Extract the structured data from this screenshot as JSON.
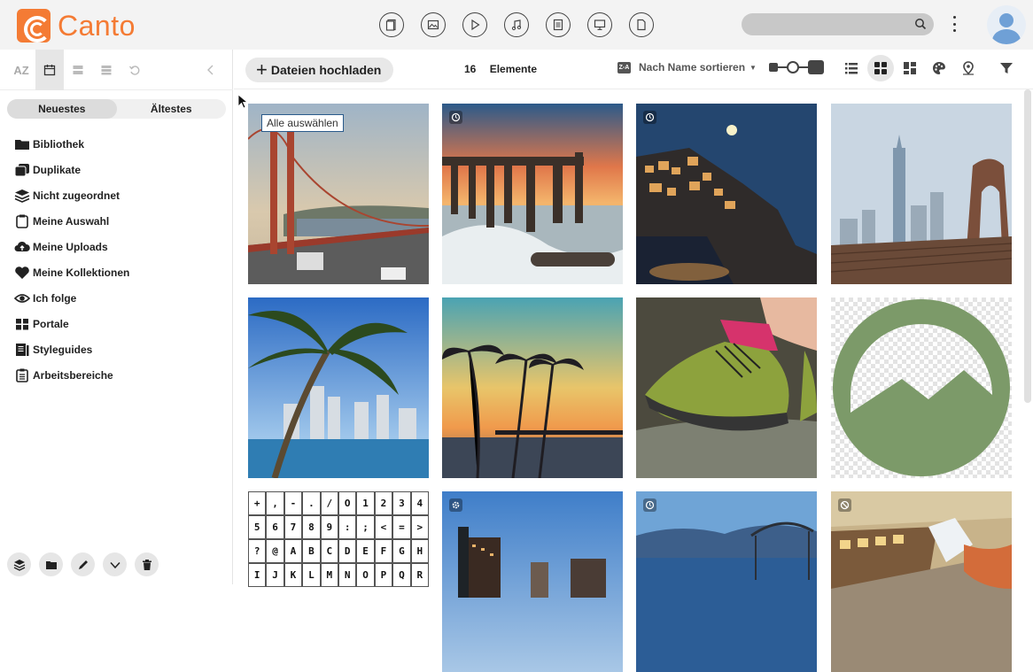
{
  "app": {
    "name": "Canto",
    "brand_color": "#f47b34"
  },
  "header": {
    "type_icons": [
      "document-icon",
      "image-icon",
      "video-icon",
      "audio-icon",
      "text-doc-icon",
      "presentation-icon",
      "other-file-icon"
    ],
    "search": {
      "placeholder": "",
      "value": ""
    }
  },
  "sidebar": {
    "sort_buttons": [
      "AZ",
      "calendar-icon",
      "size-icon",
      "layer-icon",
      "reset-icon"
    ],
    "sort_az_label": "AZ",
    "segments": {
      "newest": "Neuestes",
      "oldest": "Ältestes"
    },
    "items": [
      {
        "label": "Bibliothek",
        "icon": "folder-icon"
      },
      {
        "label": "Duplikate",
        "icon": "duplicate-icon"
      },
      {
        "label": "Nicht zugeordnet",
        "icon": "layers-icon"
      },
      {
        "label": "Meine Auswahl",
        "icon": "clipboard-icon"
      },
      {
        "label": "Meine Uploads",
        "icon": "cloud-upload-icon"
      },
      {
        "label": "Meine Kollektionen",
        "icon": "heart-icon"
      },
      {
        "label": "Ich folge",
        "icon": "eye-icon"
      },
      {
        "label": "Portale",
        "icon": "grid-icon"
      },
      {
        "label": "Styleguides",
        "icon": "book-icon"
      },
      {
        "label": "Arbeitsbereiche",
        "icon": "workspace-icon"
      }
    ]
  },
  "toolbar": {
    "upload_label": "Dateien hochladen",
    "count": "16",
    "count_label": "Elemente",
    "sort_badge": "Z-A",
    "sort_label": "Nach Name sortieren"
  },
  "grid": {
    "select_all_label": "Alle auswählen",
    "chart_symbols": [
      "+",
      ",",
      "-",
      ".",
      "/",
      "O",
      "1",
      "2",
      "3",
      "4",
      "5",
      "6",
      "7",
      "8",
      "9",
      ":",
      ";",
      "<",
      "=",
      ">",
      "?",
      "@",
      "A",
      "B",
      "C",
      "D",
      "E",
      "F",
      "G",
      "H",
      "I",
      "J",
      "K",
      "L",
      "M",
      "N",
      "O",
      "P",
      "Q",
      "R"
    ]
  }
}
